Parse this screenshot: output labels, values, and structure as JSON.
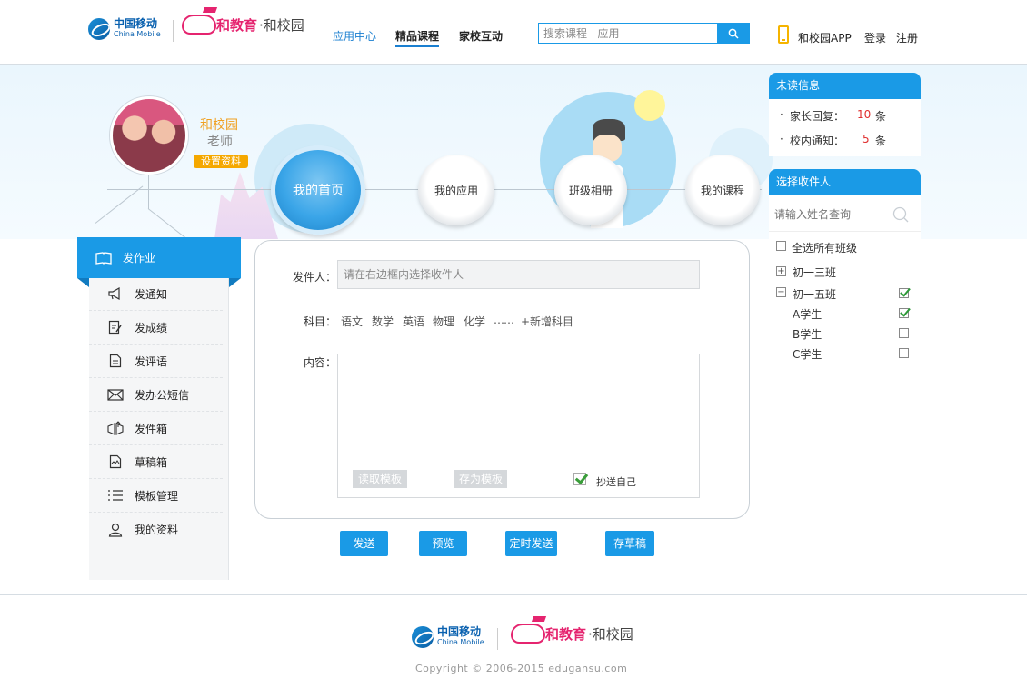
{
  "header": {
    "brand_zh": "中国移动",
    "brand_en": "China Mobile",
    "product_a": "和教育",
    "product_b": "·和校园",
    "nav": [
      "应用中心",
      "精品课程",
      "家校互动"
    ],
    "search_placeholder": "搜索课程   应用",
    "app_label": "和校园APP",
    "login": "登录",
    "register": "注册"
  },
  "profile": {
    "name": "和校园",
    "role": "老师",
    "settings": "设置资料"
  },
  "circles": [
    "我的首页",
    "我的应用",
    "班级相册",
    "我的课程"
  ],
  "sidebar": {
    "items": [
      {
        "label": "发作业",
        "icon": "book-icon"
      },
      {
        "label": "发通知",
        "icon": "megaphone-icon"
      },
      {
        "label": "发成绩",
        "icon": "edit-score-icon"
      },
      {
        "label": "发评语",
        "icon": "document-icon"
      },
      {
        "label": "发办公短信",
        "icon": "envelope-icon"
      },
      {
        "label": "发件箱",
        "icon": "outbox-icon"
      },
      {
        "label": "草稿箱",
        "icon": "draft-icon"
      },
      {
        "label": "模板管理",
        "icon": "list-icon"
      },
      {
        "label": "我的资料",
        "icon": "user-icon"
      }
    ]
  },
  "form": {
    "sender_label": "发件人：",
    "sender_placeholder": "请在右边框内选择收件人",
    "subject_label": "科目：",
    "subjects": [
      "语文",
      "数学",
      "英语",
      "物理",
      "化学",
      "……",
      "+新增科目"
    ],
    "content_label": "内容：",
    "read_template": "读取模板",
    "save_template": "存为模板",
    "cc_self": "抄送自己",
    "cc_self_checked": true
  },
  "actions": [
    "发送",
    "预览",
    "定时发送",
    "存草稿"
  ],
  "unread": {
    "title": "未读信息",
    "rows": [
      {
        "label": "家长回复：",
        "count": "10",
        "unit": "条"
      },
      {
        "label": "校内通知：",
        "count": "5",
        "unit": "条"
      }
    ]
  },
  "recipients": {
    "title": "选择收件人",
    "search_placeholder": "请输入姓名查询",
    "select_all": "全选所有班级",
    "select_all_checked": false,
    "classes": [
      {
        "name": "初一三班",
        "expanded": false,
        "checked": false
      },
      {
        "name": "初一五班",
        "expanded": true,
        "checked": true
      }
    ],
    "students": [
      {
        "name": "A学生",
        "checked": true
      },
      {
        "name": "B学生",
        "checked": false
      },
      {
        "name": "C学生",
        "checked": false
      }
    ]
  },
  "footer": {
    "copyright": "Copyright © 2006-2015   edugansu.com"
  },
  "colors": {
    "accent": "#1a9ae6",
    "brand_pink": "#e5246f",
    "brand_blue": "#0b62b0",
    "orange": "#f5a800",
    "alert_red": "#e03030"
  }
}
